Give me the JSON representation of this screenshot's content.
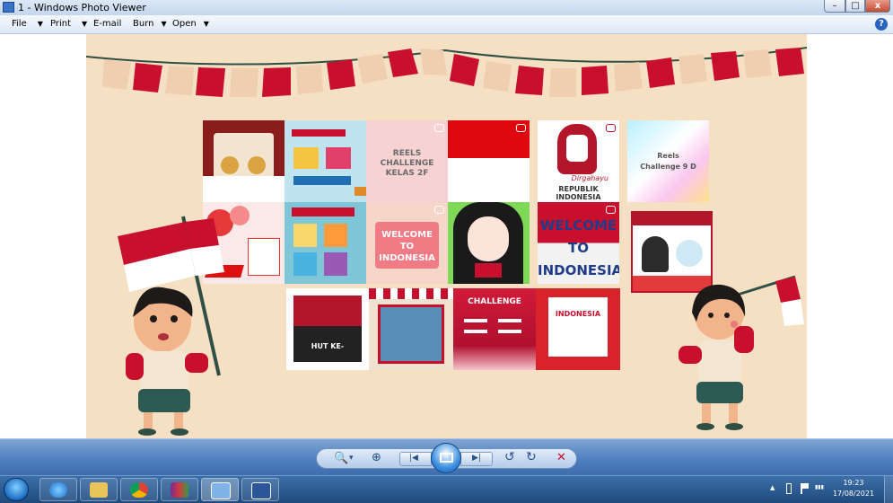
{
  "window": {
    "title": "1 - Windows Photo Viewer",
    "minimize": "–",
    "maximize": "□",
    "close": "x"
  },
  "menu": {
    "file": "File",
    "print": "Print",
    "email": "E-mail",
    "burn": "Burn",
    "open": "Open",
    "caret": "▼",
    "help": "?"
  },
  "poster": {
    "tiles": {
      "reels_challenge_kelas": "REELS CHALLENGE KELAS 2F",
      "dirgahayu": "Dirgahayu",
      "republik_indonesia": "REPUBLIK INDONESIA",
      "reels_challenge_9d": "Reels Challenge 9 D",
      "welcome_to_indonesia": "WELCOME TO INDONESIA",
      "welcome_to_indonesia_2": "WELCOME TO INDONESIA",
      "hut_ke": "HUT KE-",
      "challenge": "CHALLENGE",
      "indonesia": "INDONESIA"
    }
  },
  "toolbar": {
    "zoom": "🔍",
    "zoom_caret": "▾",
    "actual_size": "⊕",
    "previous": "|◀",
    "next": "▶|",
    "rotate_ccw": "↺",
    "rotate_cw": "↻",
    "delete": "✕"
  },
  "taskbar": {
    "time": "19:23",
    "date": "17/08/2021",
    "tray_arrow": "▲",
    "tray_signal": "▮▮▮"
  },
  "colors": {
    "flag_red": "#c8102e",
    "canvas_bg": "#f5e0c4",
    "toolbar_blue": "#4f7fbf"
  }
}
